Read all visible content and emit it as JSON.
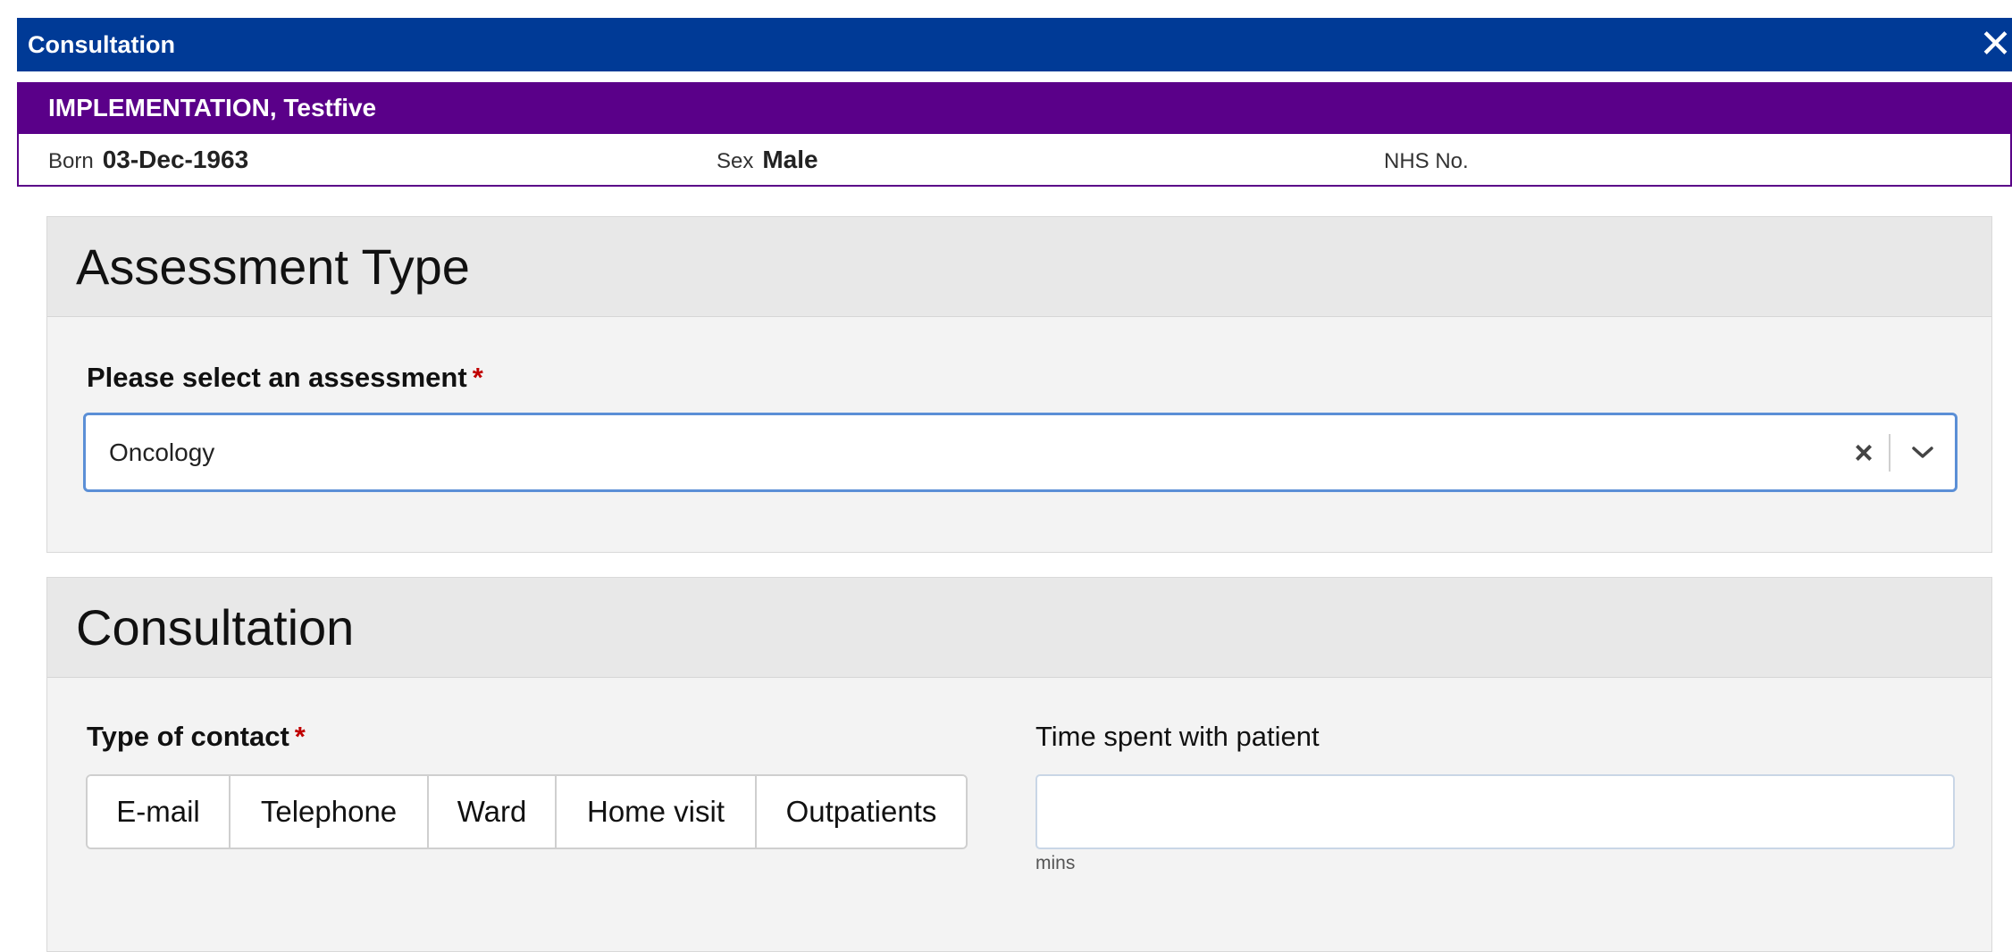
{
  "window": {
    "title": "Consultation",
    "close_icon": "close-icon"
  },
  "patient": {
    "name": "IMPLEMENTATION, Testfive",
    "born_label": "Born",
    "born_value": "03-Dec-1963",
    "sex_label": "Sex",
    "sex_value": "Male",
    "nhs_label": "NHS No.",
    "nhs_value": ""
  },
  "assessment_panel": {
    "heading": "Assessment Type",
    "field_label": "Please select an assessment",
    "required_mark": "*",
    "selected_value": "Oncology",
    "clear_icon": "clear-icon",
    "dropdown_icon": "chevron-down-icon"
  },
  "consultation_panel": {
    "heading": "Consultation",
    "contact_label": "Type of contact",
    "required_mark": "*",
    "contact_options": [
      "E-mail",
      "Telephone",
      "Ward",
      "Home visit",
      "Outpatients"
    ],
    "time_label": "Time spent with patient",
    "time_value": "",
    "time_unit": "mins"
  },
  "colors": {
    "titlebar": "#003a96",
    "patient_banner": "#5a0089",
    "required": "#c00000",
    "focus_border": "#5b8fd6"
  }
}
